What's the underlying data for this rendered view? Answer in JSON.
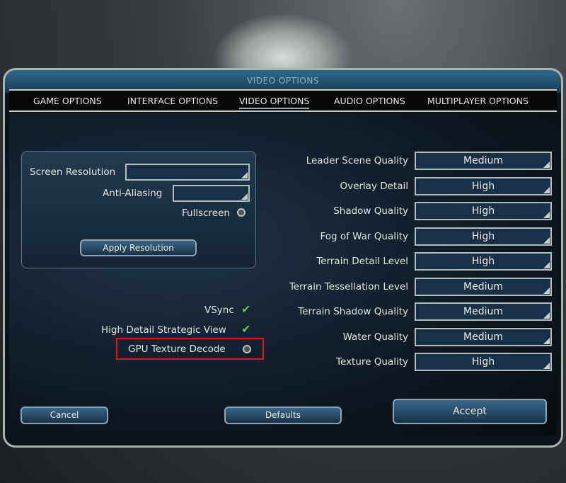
{
  "window": {
    "title": "VIDEO OPTIONS"
  },
  "tabs": [
    {
      "label": "GAME OPTIONS"
    },
    {
      "label": "INTERFACE OPTIONS"
    },
    {
      "label": "VIDEO OPTIONS",
      "active": true
    },
    {
      "label": "AUDIO OPTIONS"
    },
    {
      "label": "MULTIPLAYER OPTIONS"
    }
  ],
  "resolution": {
    "screen_resolution_label": "Screen Resolution",
    "screen_resolution_value": "",
    "anti_aliasing_label": "Anti-Aliasing",
    "anti_aliasing_value": "",
    "fullscreen_label": "Fullscreen",
    "fullscreen_checked": false,
    "apply_label": "Apply Resolution"
  },
  "toggles": [
    {
      "label": "VSync",
      "checked": true
    },
    {
      "label": "High Detail Strategic View",
      "checked": true
    },
    {
      "label": "GPU Texture Decode",
      "checked": false,
      "highlighted": true
    }
  ],
  "settings": [
    {
      "label": "Leader Scene Quality",
      "value": "Medium"
    },
    {
      "label": "Overlay Detail",
      "value": "High"
    },
    {
      "label": "Shadow Quality",
      "value": "High"
    },
    {
      "label": "Fog of War Quality",
      "value": "High"
    },
    {
      "label": "Terrain Detail Level",
      "value": "High"
    },
    {
      "label": "Terrain Tessellation Level",
      "value": "Medium"
    },
    {
      "label": "Terrain Shadow Quality",
      "value": "Medium"
    },
    {
      "label": "Water Quality",
      "value": "Medium"
    },
    {
      "label": "Texture Quality",
      "value": "High"
    }
  ],
  "buttons": {
    "cancel": "Cancel",
    "defaults": "Defaults",
    "accept": "Accept"
  },
  "colors": {
    "highlight": "#e0151b",
    "check": "#6cc24a"
  }
}
